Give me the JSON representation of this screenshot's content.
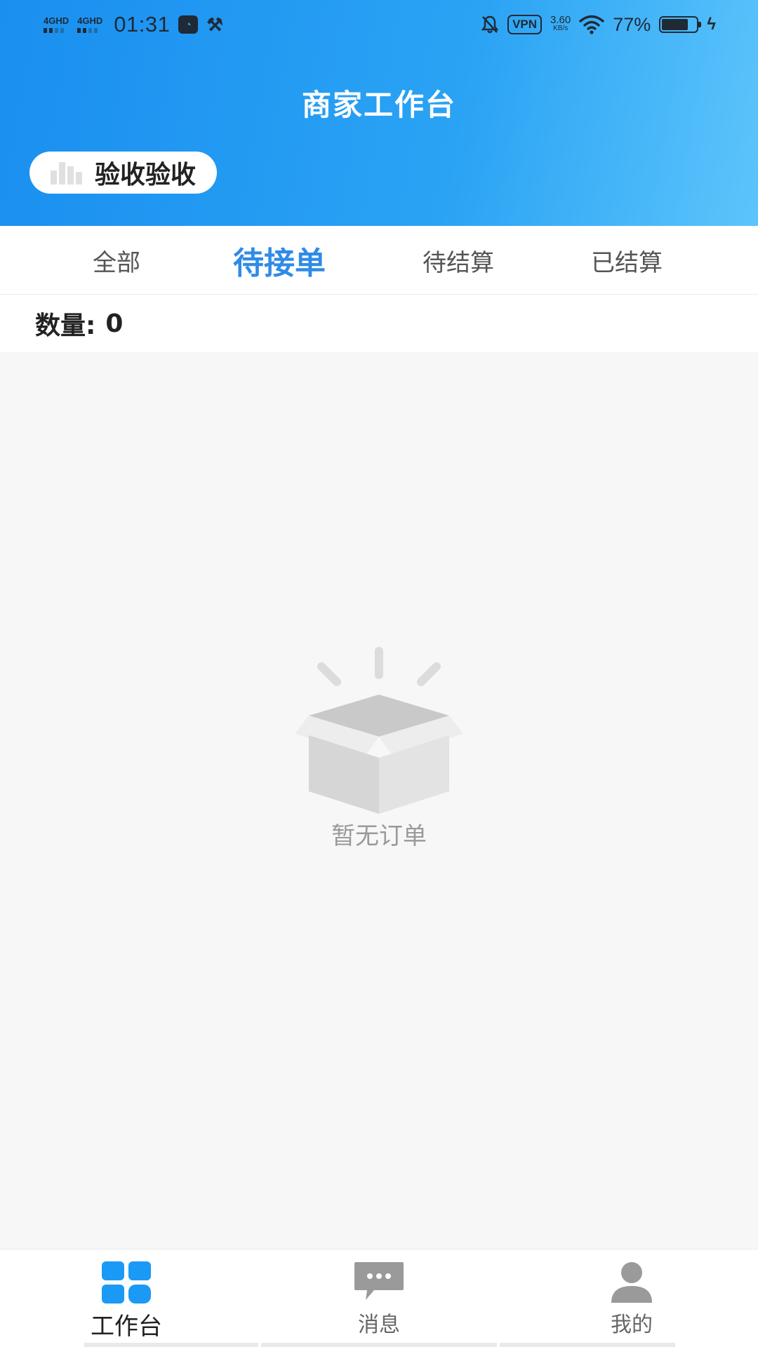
{
  "status_bar": {
    "signal_1": "4GHD",
    "signal_2": "4GHD",
    "time": "01:31",
    "vpn": "VPN",
    "speed_value": "3.60",
    "speed_unit": "KB/s",
    "battery": "77%",
    "battery_level": 0.77
  },
  "header": {
    "title": "商家工作台",
    "shop_name": "验收验收"
  },
  "tabs": [
    {
      "label": "全部",
      "active": false
    },
    {
      "label": "待接单",
      "active": true
    },
    {
      "label": "待结算",
      "active": false
    },
    {
      "label": "已结算",
      "active": false
    }
  ],
  "count": {
    "label": "数量:",
    "value": "0"
  },
  "empty_state": {
    "icon": "empty-box-icon",
    "text": "暂无订单"
  },
  "bottom_nav": [
    {
      "label": "工作台",
      "icon": "dashboard-grid-icon",
      "active": true
    },
    {
      "label": "消息",
      "icon": "message-bubble-icon",
      "active": false
    },
    {
      "label": "我的",
      "icon": "user-profile-icon",
      "active": false
    }
  ],
  "colors": {
    "header_start": "#1a8ff0",
    "header_end": "#5cc4fb",
    "active_tab": "#2f8be8",
    "nav_active_icon": "#1a9af5",
    "nav_inactive_icon": "#9a9a9a"
  }
}
